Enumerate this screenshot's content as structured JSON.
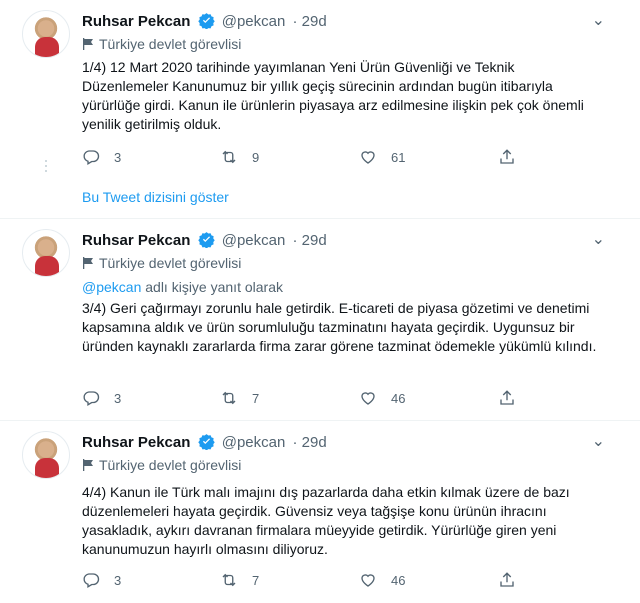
{
  "tweets": [
    {
      "name": "Ruhsar Pekcan",
      "handle": "@pekcan",
      "time": "· 29d",
      "label": "Türkiye devlet görevlisi",
      "replying_prefix": "",
      "replying_mention": "",
      "replying_suffix": "",
      "text": "1/4) 12 Mart 2020 tarihinde yayımlanan Yeni Ürün Güvenliği ve Teknik Düzenlemeler Kanunumuz bir yıllık geçiş sürecinin ardından bugün itibarıyla yürürlüğe girdi. Kanun ile ürünlerin piyasaya arz edilmesine ilişkin pek çok önemli yenilik getirilmiş olduk.",
      "replies": "3",
      "retweets": "9",
      "likes": "61"
    },
    {
      "name": "Ruhsar Pekcan",
      "handle": "@pekcan",
      "time": "· 29d",
      "label": "Türkiye devlet görevlisi",
      "replying_mention": "@pekcan",
      "replying_suffix": " adlı kişiye yanıt olarak",
      "text": "3/4) Geri çağırmayı zorunlu hale getirdik. E-ticareti de piyasa gözetimi ve denetimi kapsamına aldık ve ürün sorumluluğu tazminatını hayata geçirdik. Uygunsuz bir üründen kaynaklı zararlarda firma zarar görene tazminat ödemekle yükümlü kılındı.",
      "replies": "3",
      "retweets": "7",
      "likes": "46"
    },
    {
      "name": "Ruhsar Pekcan",
      "handle": "@pekcan",
      "time": "· 29d",
      "label": "Türkiye devlet görevlisi",
      "text": "4/4) Kanun ile Türk malı imajını dış pazarlarda daha etkin kılmak üzere de bazı düzenlemeleri hayata geçirdik. Güvensiz veya tağşişe konu ürünün ihracını yasakladık, aykırı davranan firmalara müeyyide getirdik. Yürürlüğe giren yeni kanunumuzun hayırlı olmasını diliyoruz.",
      "replies": "3",
      "retweets": "7",
      "likes": "46"
    }
  ],
  "show_thread": "Bu Tweet dizisini göster",
  "colors": {
    "accent": "#1d9bf0",
    "muted": "#536471",
    "text": "#0f1419"
  },
  "icons": [
    "verified-badge-icon",
    "government-flag-icon",
    "reply-icon",
    "retweet-icon",
    "like-icon",
    "share-icon",
    "more-options-icon"
  ]
}
